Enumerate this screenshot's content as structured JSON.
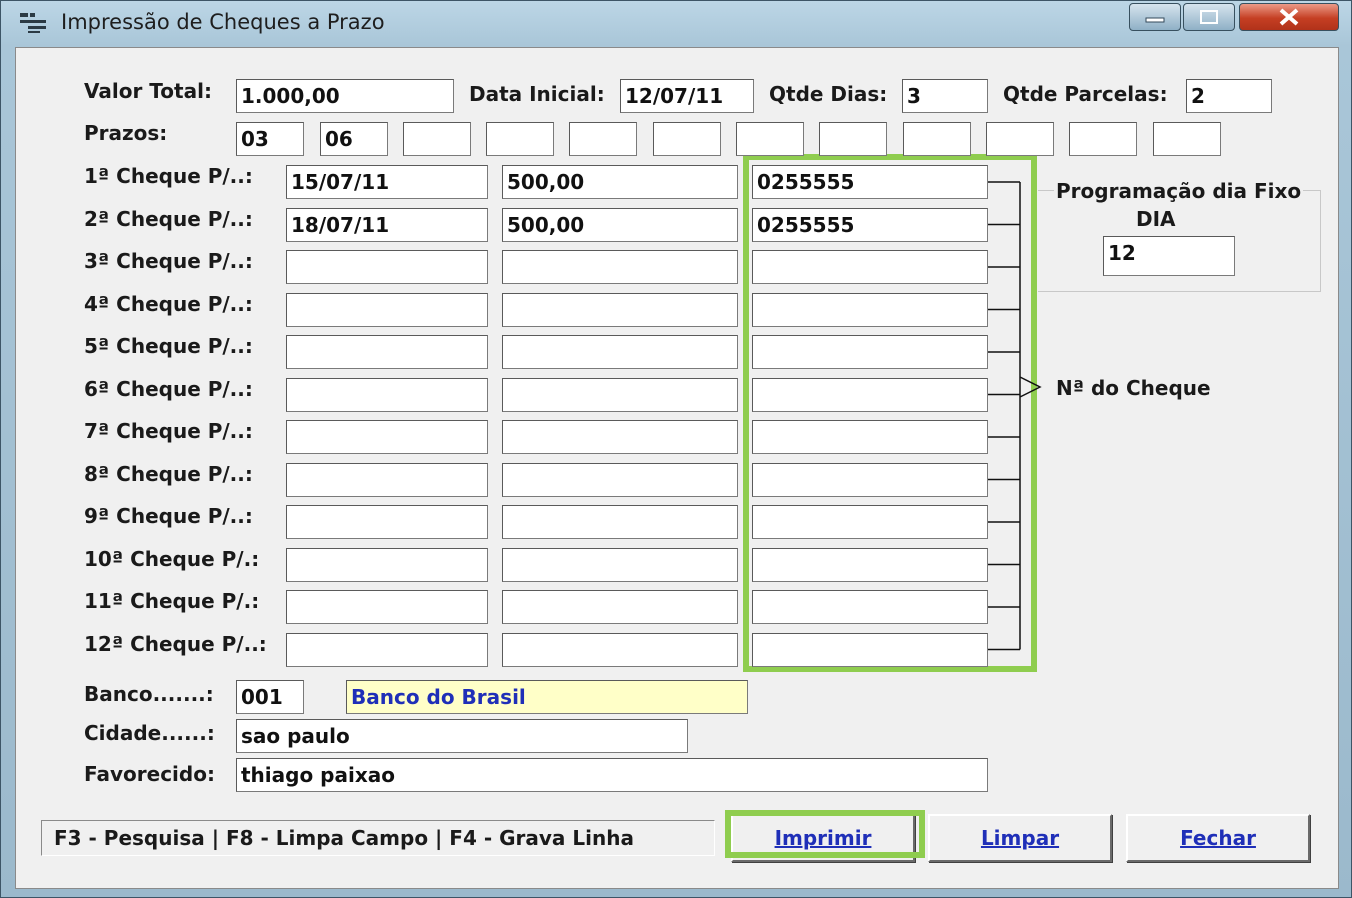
{
  "window": {
    "title": "Impressão de Cheques a Prazo"
  },
  "caption": {
    "minimize_icon": "minimize-icon",
    "maximize_icon": "maximize-icon",
    "close_icon": "close-icon"
  },
  "header": {
    "valor_total_label": "Valor Total:",
    "valor_total": "1.000,00",
    "data_inicial_label": "Data Inicial:",
    "data_inicial": "12/07/11",
    "qtde_dias_label": "Qtde Dias:",
    "qtde_dias": "3",
    "qtde_parcelas_label": "Qtde Parcelas:",
    "qtde_parcelas": "2"
  },
  "prazos": {
    "label": "Prazos:",
    "values": [
      "03",
      "06",
      "",
      "",
      "",
      "",
      "",
      "",
      "",
      "",
      "",
      ""
    ]
  },
  "cheques": [
    {
      "label": "1ª Cheque P/..:",
      "date": "15/07/11",
      "value": "500,00",
      "number": "0255555"
    },
    {
      "label": "2ª Cheque P/..:",
      "date": "18/07/11",
      "value": "500,00",
      "number": "0255555"
    },
    {
      "label": "3ª Cheque P/..:",
      "date": "",
      "value": "",
      "number": ""
    },
    {
      "label": "4ª Cheque P/..:",
      "date": "",
      "value": "",
      "number": ""
    },
    {
      "label": "5ª Cheque P/..:",
      "date": "",
      "value": "",
      "number": ""
    },
    {
      "label": "6ª Cheque P/..:",
      "date": "",
      "value": "",
      "number": ""
    },
    {
      "label": "7ª Cheque P/..:",
      "date": "",
      "value": "",
      "number": ""
    },
    {
      "label": "8ª Cheque P/..:",
      "date": "",
      "value": "",
      "number": ""
    },
    {
      "label": "9ª Cheque P/..:",
      "date": "",
      "value": "",
      "number": ""
    },
    {
      "label": "10ª Cheque P/.:",
      "date": "",
      "value": "",
      "number": ""
    },
    {
      "label": "11ª Cheque P/.:",
      "date": "",
      "value": "",
      "number": ""
    },
    {
      "label": "12ª Cheque P/..:",
      "date": "",
      "value": "",
      "number": ""
    }
  ],
  "programacao": {
    "title": "Programação dia Fixo",
    "dia_label": "DIA",
    "dia": "12"
  },
  "numero_cheque_label": "Nª do Cheque",
  "banco": {
    "label": "Banco.......:",
    "code": "001",
    "name": "Banco do Brasil"
  },
  "cidade": {
    "label": "Cidade......:",
    "value": "sao paulo"
  },
  "favorecido": {
    "label": "Favorecido:",
    "value": "thiago paixao"
  },
  "status": {
    "text": "F3 - Pesquisa  |  F8 - Limpa Campo  |  F4 - Grava Linha"
  },
  "buttons": {
    "imprimir": "Imprimir",
    "limpar": "Limpar",
    "fechar": "Fechar"
  },
  "colors": {
    "highlight": "#8fcd4f",
    "bank_name_bg": "#ffffc8",
    "button_text": "#1f2fb8"
  }
}
